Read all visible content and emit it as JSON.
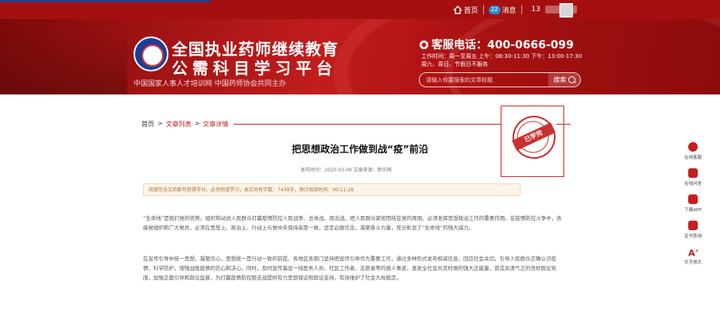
{
  "topbar": {
    "home_label": "首页",
    "msg_badge": "22",
    "msg_label": "消息",
    "user_number": "13"
  },
  "banner": {
    "title_line1": "全国执业药师继续教育",
    "title_line2": "公需科目学习平台",
    "slogan": "中国国家人事人才培训网   中国药师协会共同主办",
    "hotline": "客服电话：400-0666-099",
    "hours_line1": "工作时间：周一至周五 上午：08:30-11:30 下午：13:00-17:30",
    "hours_line2": "周六、周日、节假日不服务",
    "search_placeholder": "请输入你要搜索的文章标题",
    "search_button": "搜索"
  },
  "breadcrumb": {
    "home": "首页",
    "sep": ">",
    "list": "文章列表",
    "detail": "文章详情"
  },
  "article": {
    "title": "把思想政治工作做到战“疫”前沿",
    "meta": "发布时间：2020-03-09   文章来源：新华网",
    "notice": "阅读完全文后即可获得学分，必须完成学习，本文共有字数：7439字，预计阅读时间：00:11:26",
    "para1": "“生命线”是我们党的优势。组织和动员人民群众打赢疫情防控人民战争、总体战、阻击战，把人民群众紧密团结在党的周围，必须发挥思想政治工作的重要作用。在疫情防控斗争中，各级党组织和广大党员，必须在思想上、政治上、行动上与党中央保持高度一致，坚定必胜信念，凝聚奋斗力量，充分彰显了“生命线”的强大威力。",
    "para2": "在宣传引导中统一思想，凝聚信心。思想统一是行动一致的前提。各地区各部门坚持把宣传引导作为重要工作，通过多种形式发布权威信息、回应社会关切，引导人民群众正确认识疫情、科学防护，增强战胜疫情的信心和决心。同时，及时宣传基层一线医务人员、社区工作者、志愿者等的感人事迹，激发全社会共克时艰的强大正能量，营造风清气正的良好舆论氛围，加强正面引导和舆论监督，为打赢疫情防控阻击战提供有力思想保证和舆论支持，有效维护了社会大局稳定。"
  },
  "stamp": {
    "text": "已学完"
  },
  "floatbar": {
    "items": [
      {
        "label": "在线客服",
        "icon": "headset-icon"
      },
      {
        "label": "在线问答",
        "icon": "chat-icon"
      },
      {
        "label": "下载APP",
        "icon": "app-icon"
      },
      {
        "label": "证书查询",
        "icon": "certificate-icon"
      },
      {
        "label": "文字放大",
        "icon": "font-size-icon"
      }
    ]
  },
  "colors": {
    "brand_red": "#a50f0f",
    "accent_red": "#c01d1d",
    "notice_bg": "#fdf4e8"
  }
}
